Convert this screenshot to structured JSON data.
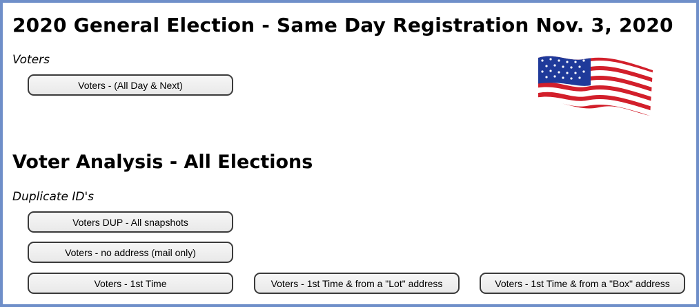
{
  "section1": {
    "title": "2020 General Election - Same Day Registration Nov. 3, 2020",
    "group_label": "Voters",
    "buttons": [
      "Voters - (All Day & Next)"
    ]
  },
  "section2": {
    "title": "Voter Analysis - All Elections",
    "group_label": "Duplicate ID's",
    "buttons": [
      "Voters DUP - All snapshots",
      "Voters - no address (mail only)",
      "Voters - 1st Time",
      "Voters - 1st Time & from a \"Lot\" address",
      "Voters - 1st Time & from a \"Box\" address"
    ]
  },
  "icons": {
    "flag": "us-flag-icon"
  },
  "colors": {
    "frame_border": "#6f8fc9",
    "button_border": "#3a3a3a",
    "button_bg": "#eeeeee"
  }
}
